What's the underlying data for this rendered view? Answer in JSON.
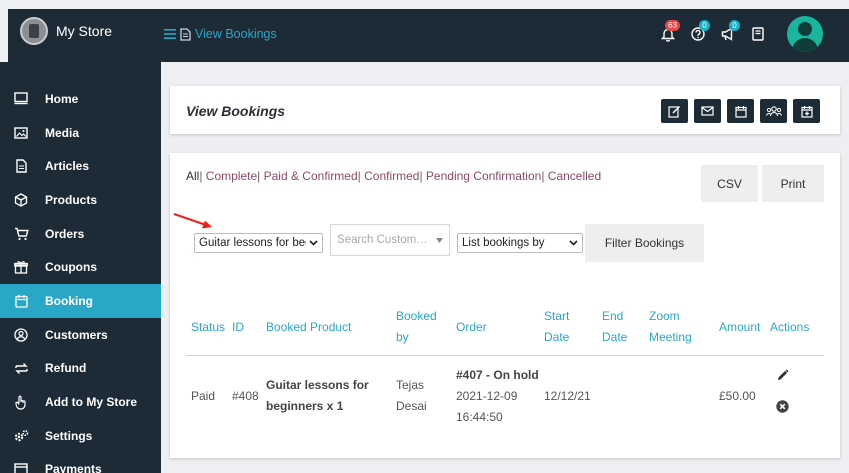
{
  "app": {
    "store_name": "My Store"
  },
  "breadcrumb": {
    "label": "View Bookings"
  },
  "topbar": {
    "notifications_count": "63",
    "help_count": "0",
    "announcements_count": "0"
  },
  "sidebar": {
    "items": [
      {
        "label": "Home",
        "icon": "monitor-icon"
      },
      {
        "label": "Media",
        "icon": "image-icon"
      },
      {
        "label": "Articles",
        "icon": "document-icon"
      },
      {
        "label": "Products",
        "icon": "cube-icon"
      },
      {
        "label": "Orders",
        "icon": "cart-icon"
      },
      {
        "label": "Coupons",
        "icon": "gift-icon"
      },
      {
        "label": "Booking",
        "icon": "calendar-icon",
        "active": true
      },
      {
        "label": "Customers",
        "icon": "user-circle-icon"
      },
      {
        "label": "Refund",
        "icon": "refund-icon"
      },
      {
        "label": "Add to My Store",
        "icon": "hand-pointer-icon"
      },
      {
        "label": "Settings",
        "icon": "gears-icon"
      },
      {
        "label": "Payments",
        "icon": "payments-icon"
      }
    ]
  },
  "page": {
    "title": "View Bookings"
  },
  "filters": {
    "all": "All",
    "complete": "Complete",
    "paid_confirmed": "Paid & Confirmed",
    "confirmed": "Confirmed",
    "pending": "Pending Confirmation",
    "cancelled": "Cancelled"
  },
  "export": {
    "csv": "CSV",
    "print": "Print"
  },
  "controls": {
    "product_select": "Guitar lessons for beginners",
    "customer_search_placeholder": "Search Custom…",
    "list_by": "List bookings by",
    "filter_button": "Filter Bookings"
  },
  "table": {
    "headers": {
      "status": "Status",
      "id": "ID",
      "product": "Booked Product",
      "booked_by_1": "Booked",
      "booked_by_2": "by",
      "order": "Order",
      "start_1": "Start",
      "start_2": "Date",
      "end_1": "End",
      "end_2": "Date",
      "zoom_1": "Zoom",
      "zoom_2": "Meeting",
      "amount": "Amount",
      "actions": "Actions"
    },
    "rows": [
      {
        "status": "Paid",
        "id": "#408",
        "product_1": "Guitar lessons for",
        "product_2": "beginners x 1",
        "customer_1": "Tejas",
        "customer_2": "Desai",
        "order_title": "#407 - On hold",
        "order_date": "2021-12-09",
        "order_time": "16:44:50",
        "start_date": "12/12/21",
        "end_date": "",
        "zoom": "",
        "amount": "£50.00"
      }
    ]
  },
  "colors": {
    "sidebar_bg": "#1c2b36",
    "accent": "#2aa7c6",
    "filter_link": "#8d4a69",
    "badge_red": "#e24a4a",
    "badge_teal": "#1ab3c8",
    "avatar": "#19b59c",
    "annotation_arrow": "#e8221b"
  }
}
